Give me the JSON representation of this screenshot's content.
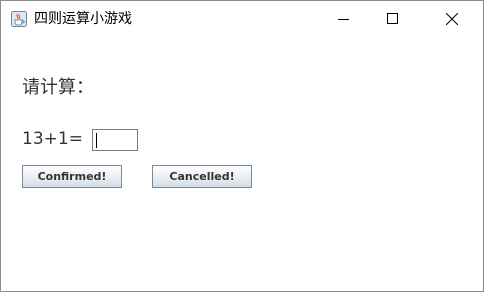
{
  "window": {
    "title": "四则运算小游戏",
    "app_icon": "java-coffee-cup-icon",
    "controls": [
      "minimize-icon",
      "maximize-icon",
      "close-icon"
    ]
  },
  "main": {
    "prompt_label": "请计算：",
    "question": "13+1=",
    "answer": {
      "value": "",
      "placeholder": ""
    },
    "confirm_label": "Confirmed!",
    "cancel_label": "Cancelled!"
  },
  "colors": {
    "button_border": "#7a8a99",
    "button_top": "#ffffff",
    "button_bottom": "#d2dbe4",
    "text": "#333333"
  }
}
